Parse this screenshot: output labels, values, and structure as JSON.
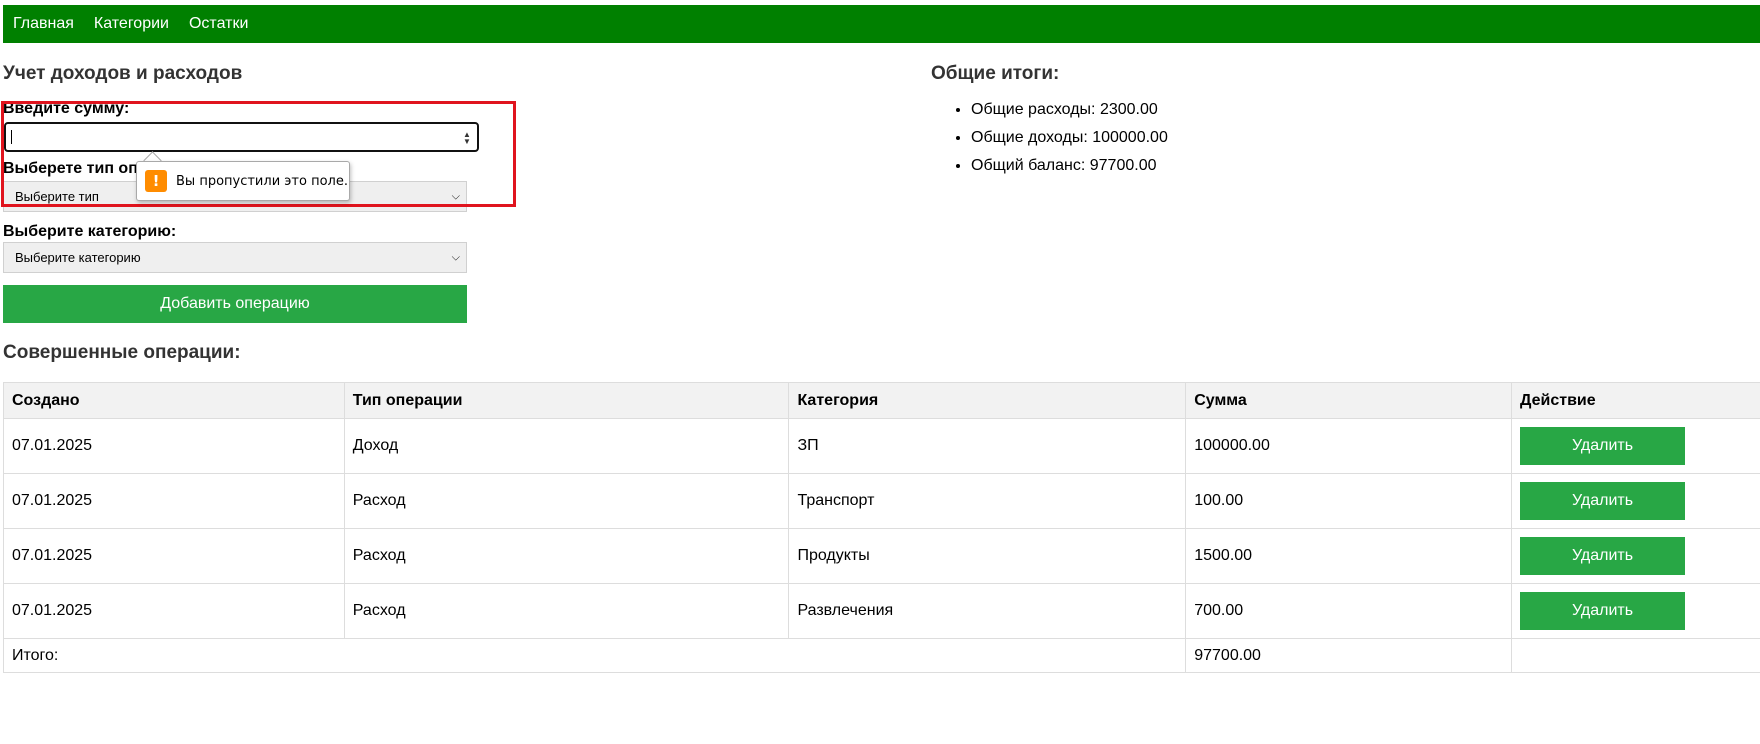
{
  "nav": {
    "items": [
      {
        "label": "Главная"
      },
      {
        "label": "Категории"
      },
      {
        "label": "Остатки"
      }
    ]
  },
  "form": {
    "title": "Учет доходов и расходов",
    "amount_label": "Введите сумму:",
    "amount_value": "",
    "type_label": "Выберете тип операции:",
    "type_selected": "Выберите тип",
    "category_label": "Выберите категорию:",
    "category_selected": "Выберите категорию",
    "submit_label": "Добавить операцию",
    "validation_tooltip": "Вы пропустили это поле."
  },
  "totals": {
    "title": "Общие итоги:",
    "items": [
      {
        "text": "Общие расходы: 2300.00"
      },
      {
        "text": "Общие доходы: 100000.00"
      },
      {
        "text": "Общий баланс: 97700.00"
      }
    ]
  },
  "operations": {
    "title": "Совершенные операции:",
    "columns": [
      "Создано",
      "Тип операции",
      "Категория",
      "Сумма",
      "Действие"
    ],
    "rows": [
      {
        "created": "07.01.2025",
        "type": "Доход",
        "category": "ЗП",
        "amount": "100000.00",
        "action": "Удалить"
      },
      {
        "created": "07.01.2025",
        "type": "Расход",
        "category": "Транспорт",
        "amount": "100.00",
        "action": "Удалить"
      },
      {
        "created": "07.01.2025",
        "type": "Расход",
        "category": "Продукты",
        "amount": "1500.00",
        "action": "Удалить"
      },
      {
        "created": "07.01.2025",
        "type": "Расход",
        "category": "Развлечения",
        "amount": "700.00",
        "action": "Удалить"
      }
    ],
    "total_label": "Итого:",
    "total_amount": "97700.00"
  },
  "colors": {
    "navbar": "#008000",
    "button": "#28a745",
    "highlight": "#e0141e",
    "warning": "#ff8c00"
  },
  "icons": {
    "warning": "warning-icon",
    "spinner": "number-spinner-icon",
    "select_arrow": "chevron-down-icon"
  }
}
